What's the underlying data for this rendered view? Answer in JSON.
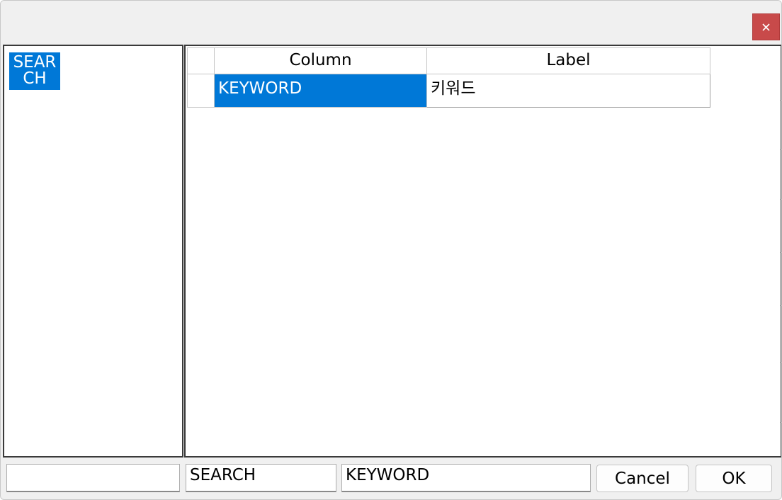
{
  "window": {
    "close_icon": "close-icon",
    "accent_color": "#0078d7",
    "close_color": "#c84a4a"
  },
  "tree": {
    "items": [
      {
        "label": "SEARCH",
        "selected": true
      }
    ]
  },
  "grid": {
    "headers": [
      "Column",
      "Label"
    ],
    "rows": [
      {
        "column": "KEYWORD",
        "label": "키워드",
        "selected_cell": "column"
      }
    ]
  },
  "bottom_bar": {
    "field_1": "",
    "field_2": "SEARCH",
    "field_3": "KEYWORD",
    "cancel_label": "Cancel",
    "ok_label": "OK"
  }
}
